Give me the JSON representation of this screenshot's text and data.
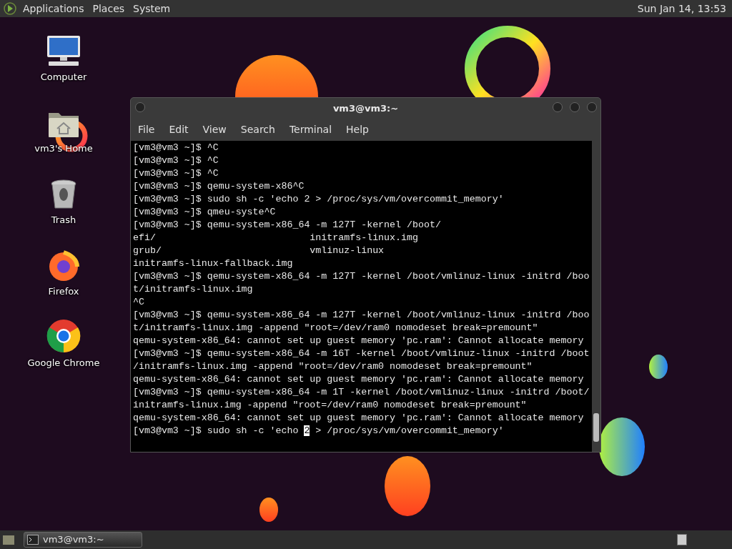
{
  "top_panel": {
    "menus": [
      "Applications",
      "Places",
      "System"
    ],
    "clock": "Sun Jan 14, 13:53"
  },
  "desktop_icons": [
    {
      "kind": "computer",
      "label": "Computer"
    },
    {
      "kind": "home",
      "label": "vm3's Home"
    },
    {
      "kind": "trash",
      "label": "Trash"
    },
    {
      "kind": "firefox",
      "label": "Firefox"
    },
    {
      "kind": "chrome",
      "label": "Google Chrome"
    }
  ],
  "terminal": {
    "title": "vm3@vm3:~",
    "menu": [
      "File",
      "Edit",
      "View",
      "Search",
      "Terminal",
      "Help"
    ],
    "lines": [
      {
        "text": "[vm3@vm3 ~]$ ^C"
      },
      {
        "text": "[vm3@vm3 ~]$ ^C"
      },
      {
        "text": "[vm3@vm3 ~]$ ^C"
      },
      {
        "text": "[vm3@vm3 ~]$ qemu-system-x86^C"
      },
      {
        "text": "[vm3@vm3 ~]$ sudo sh -c 'echo 2 > /proc/sys/vm/overcommit_memory'"
      },
      {
        "text": "[vm3@vm3 ~]$ qmeu-syste^C"
      },
      {
        "text": "[vm3@vm3 ~]$ qemu-system-x86_64 -m 127T -kernel /boot/"
      },
      {
        "text": "efi/                           initramfs-linux.img"
      },
      {
        "text": "grub/                          vmlinuz-linux"
      },
      {
        "text": "initramfs-linux-fallback.img"
      },
      {
        "text": "[vm3@vm3 ~]$ qemu-system-x86_64 -m 127T -kernel /boot/vmlinuz-linux -initrd /boo"
      },
      {
        "text": "t/initramfs-linux.img"
      },
      {
        "text": "^C"
      },
      {
        "text": "[vm3@vm3 ~]$ qemu-system-x86_64 -m 127T -kernel /boot/vmlinuz-linux -initrd /boo"
      },
      {
        "text": "t/initramfs-linux.img -append \"root=/dev/ram0 nomodeset break=premount\""
      },
      {
        "text": "qemu-system-x86_64: cannot set up guest memory 'pc.ram': Cannot allocate memory"
      },
      {
        "text": "[vm3@vm3 ~]$ qemu-system-x86_64 -m 16T -kernel /boot/vmlinuz-linux -initrd /boot"
      },
      {
        "text": "/initramfs-linux.img -append \"root=/dev/ram0 nomodeset break=premount\""
      },
      {
        "text": "qemu-system-x86_64: cannot set up guest memory 'pc.ram': Cannot allocate memory"
      },
      {
        "text": "[vm3@vm3 ~]$ qemu-system-x86_64 -m 1T -kernel /boot/vmlinuz-linux -initrd /boot/"
      },
      {
        "text": "initramfs-linux.img -append \"root=/dev/ram0 nomodeset break=premount\""
      },
      {
        "text": "qemu-system-x86_64: cannot set up guest memory 'pc.ram': Cannot allocate memory"
      },
      {
        "text": "[vm3@vm3 ~]$ sudo sh -c 'echo ",
        "cursor": "2",
        "after": " > /proc/sys/vm/overcommit_memory'"
      }
    ]
  },
  "taskbar": {
    "tasks": [
      {
        "label": "vm3@vm3:~",
        "selected": true
      }
    ]
  }
}
